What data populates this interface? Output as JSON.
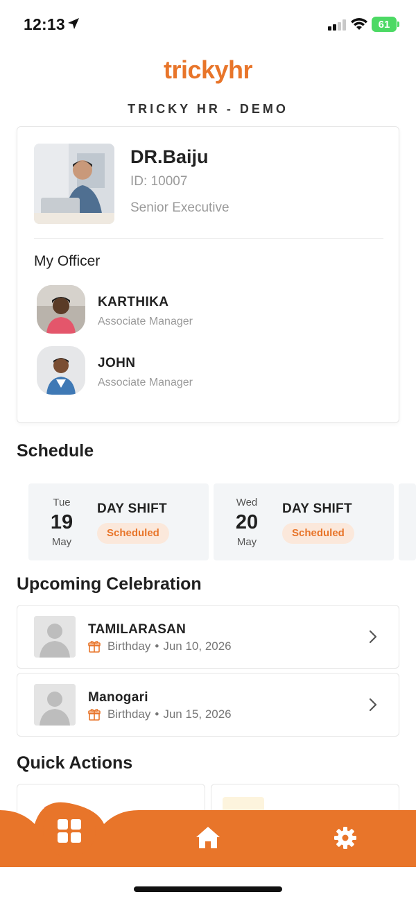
{
  "status_bar": {
    "time": "12:13",
    "battery": "61"
  },
  "brand": {
    "logo_text_a": "tricky",
    "logo_text_b": "hr",
    "company": "TRICKY HR - DEMO"
  },
  "profile": {
    "name": "DR.Baiju",
    "id": "ID: 10007",
    "role": "Senior Executive",
    "officer_heading": "My Officer",
    "officers": [
      {
        "name": "KARTHIKA",
        "role": "Associate Manager"
      },
      {
        "name": "JOHN",
        "role": "Associate Manager"
      }
    ]
  },
  "schedule": {
    "title": "Schedule",
    "shifts": [
      {
        "dow": "Tue",
        "day": "19",
        "month": "May",
        "name": "DAY SHIFT",
        "status": "Scheduled"
      },
      {
        "dow": "Wed",
        "day": "20",
        "month": "May",
        "name": "DAY SHIFT",
        "status": "Scheduled"
      }
    ]
  },
  "celebration": {
    "title": "Upcoming Celebration",
    "items": [
      {
        "name": "TAMILARASAN",
        "type": "Birthday",
        "date": "Jun 10, 2026"
      },
      {
        "name": "Manogari",
        "type": "Birthday",
        "date": "Jun 15, 2026"
      }
    ]
  },
  "quick_actions": {
    "title": "Quick Actions"
  },
  "colors": {
    "accent": "#e8752a",
    "badge_bg": "#fbe8db",
    "battery": "#4cd964"
  },
  "icons": {
    "nav": [
      "apps-grid-icon",
      "home-icon",
      "settings-gear-icon"
    ],
    "status": [
      "location-arrow-icon",
      "cellular-signal-icon",
      "wifi-icon",
      "battery-icon"
    ],
    "celebration": [
      "gift-icon",
      "chevron-right-icon"
    ]
  }
}
